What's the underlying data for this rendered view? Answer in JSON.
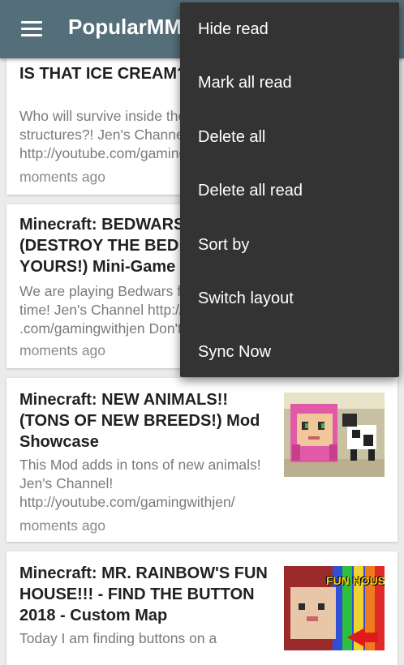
{
  "app": {
    "title": "PopularMMOs",
    "menu_icon": "hamburger-menu-icon"
  },
  "menu": {
    "items": [
      "Hide read",
      "Mark all read",
      "Delete all",
      "Delete all read",
      "Sort by",
      "Switch layout",
      "Sync Now"
    ]
  },
  "feed": [
    {
      "title": "IS THAT ICE CREAM? EAT IT!!!",
      "description": "Who will survive inside these delicious structures?! Jen's Channel! http://youtube.com/gamingwithjen/",
      "time": "moments ago"
    },
    {
      "title": "Minecraft: BEDWARS (DESTROY THE BED BEFORE YOURS!) Mini-Game",
      "description": "We are playing Bedwars for the first time! Jen's Channel http://youtube .com/gamingwithjen Don't",
      "time": "moments ago"
    },
    {
      "title": "Minecraft: NEW ANIMALS!! (TONS OF NEW BREEDS!) Mod Showcase",
      "description": "This Mod adds in tons of new animals! Jen's Channel! http://youtube.com/gamingwithjen/",
      "time": "moments ago",
      "thumbnail": "thumbnail-new-animals"
    },
    {
      "title": "Minecraft: MR. RAINBOW'S FUN HOUSE!!! - FIND THE BUTTON 2018 - Custom Map",
      "description": "Today I am finding buttons on a",
      "time": "",
      "thumbnail": "thumbnail-fun-house",
      "thumbnail_text": "FUN HOUS"
    }
  ]
}
